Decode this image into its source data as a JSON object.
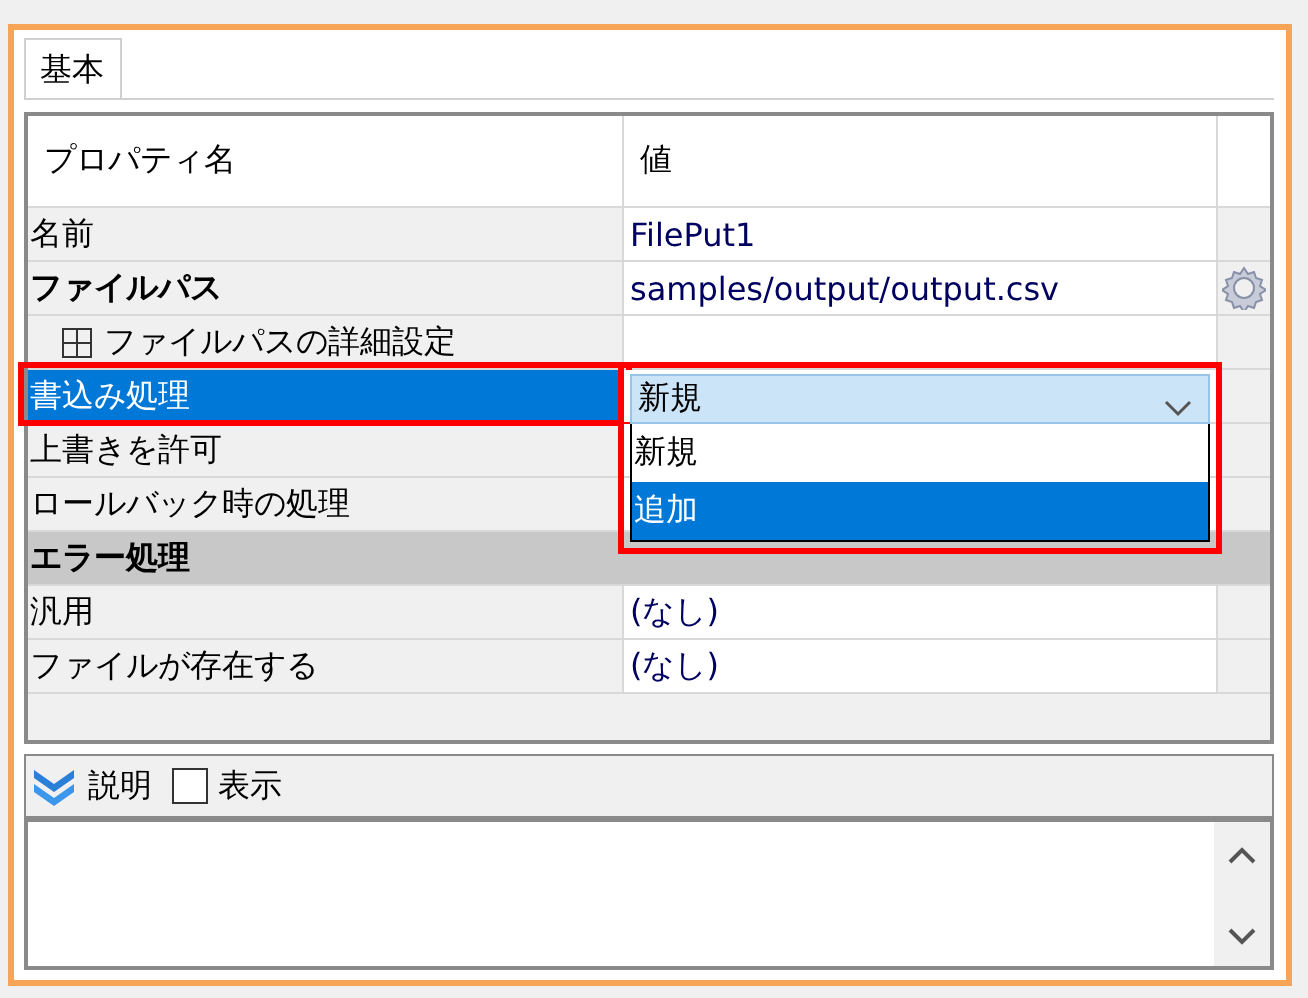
{
  "tabs": [
    {
      "label": "基本",
      "selected": true
    }
  ],
  "grid": {
    "columns": [
      "プロパティ名",
      "値"
    ],
    "rows": [
      {
        "kind": "property",
        "name": "名前",
        "value": "FilePut1",
        "bold": false,
        "selected": false
      },
      {
        "kind": "property",
        "name": "ファイルパス",
        "value": "samples/output/output.csv",
        "bold": true,
        "selected": false,
        "has_button": true
      },
      {
        "kind": "group",
        "name": "ファイルパスの詳細設定",
        "expanded": false
      },
      {
        "kind": "property",
        "name": "書込み処理",
        "value": "新規",
        "bold": false,
        "selected": true,
        "highlighted": true,
        "dropdown": {
          "options": [
            {
              "label": "新規",
              "selected": false
            },
            {
              "label": "追加",
              "selected": true
            }
          ]
        }
      },
      {
        "kind": "property",
        "name": "上書きを許可",
        "bold": false,
        "selected": false
      },
      {
        "kind": "property",
        "name": "ロールバック時の処理",
        "bold": false,
        "selected": false
      },
      {
        "kind": "category",
        "name": "エラー処理"
      },
      {
        "kind": "property",
        "name": "汎用",
        "value": "(なし)",
        "bold": false,
        "selected": false
      },
      {
        "kind": "property",
        "name": "ファイルが存在する",
        "value": "(なし)",
        "bold": false,
        "selected": false
      }
    ]
  },
  "description": {
    "title": "説明",
    "checkbox": {
      "label": "表示",
      "checked": false
    }
  }
}
